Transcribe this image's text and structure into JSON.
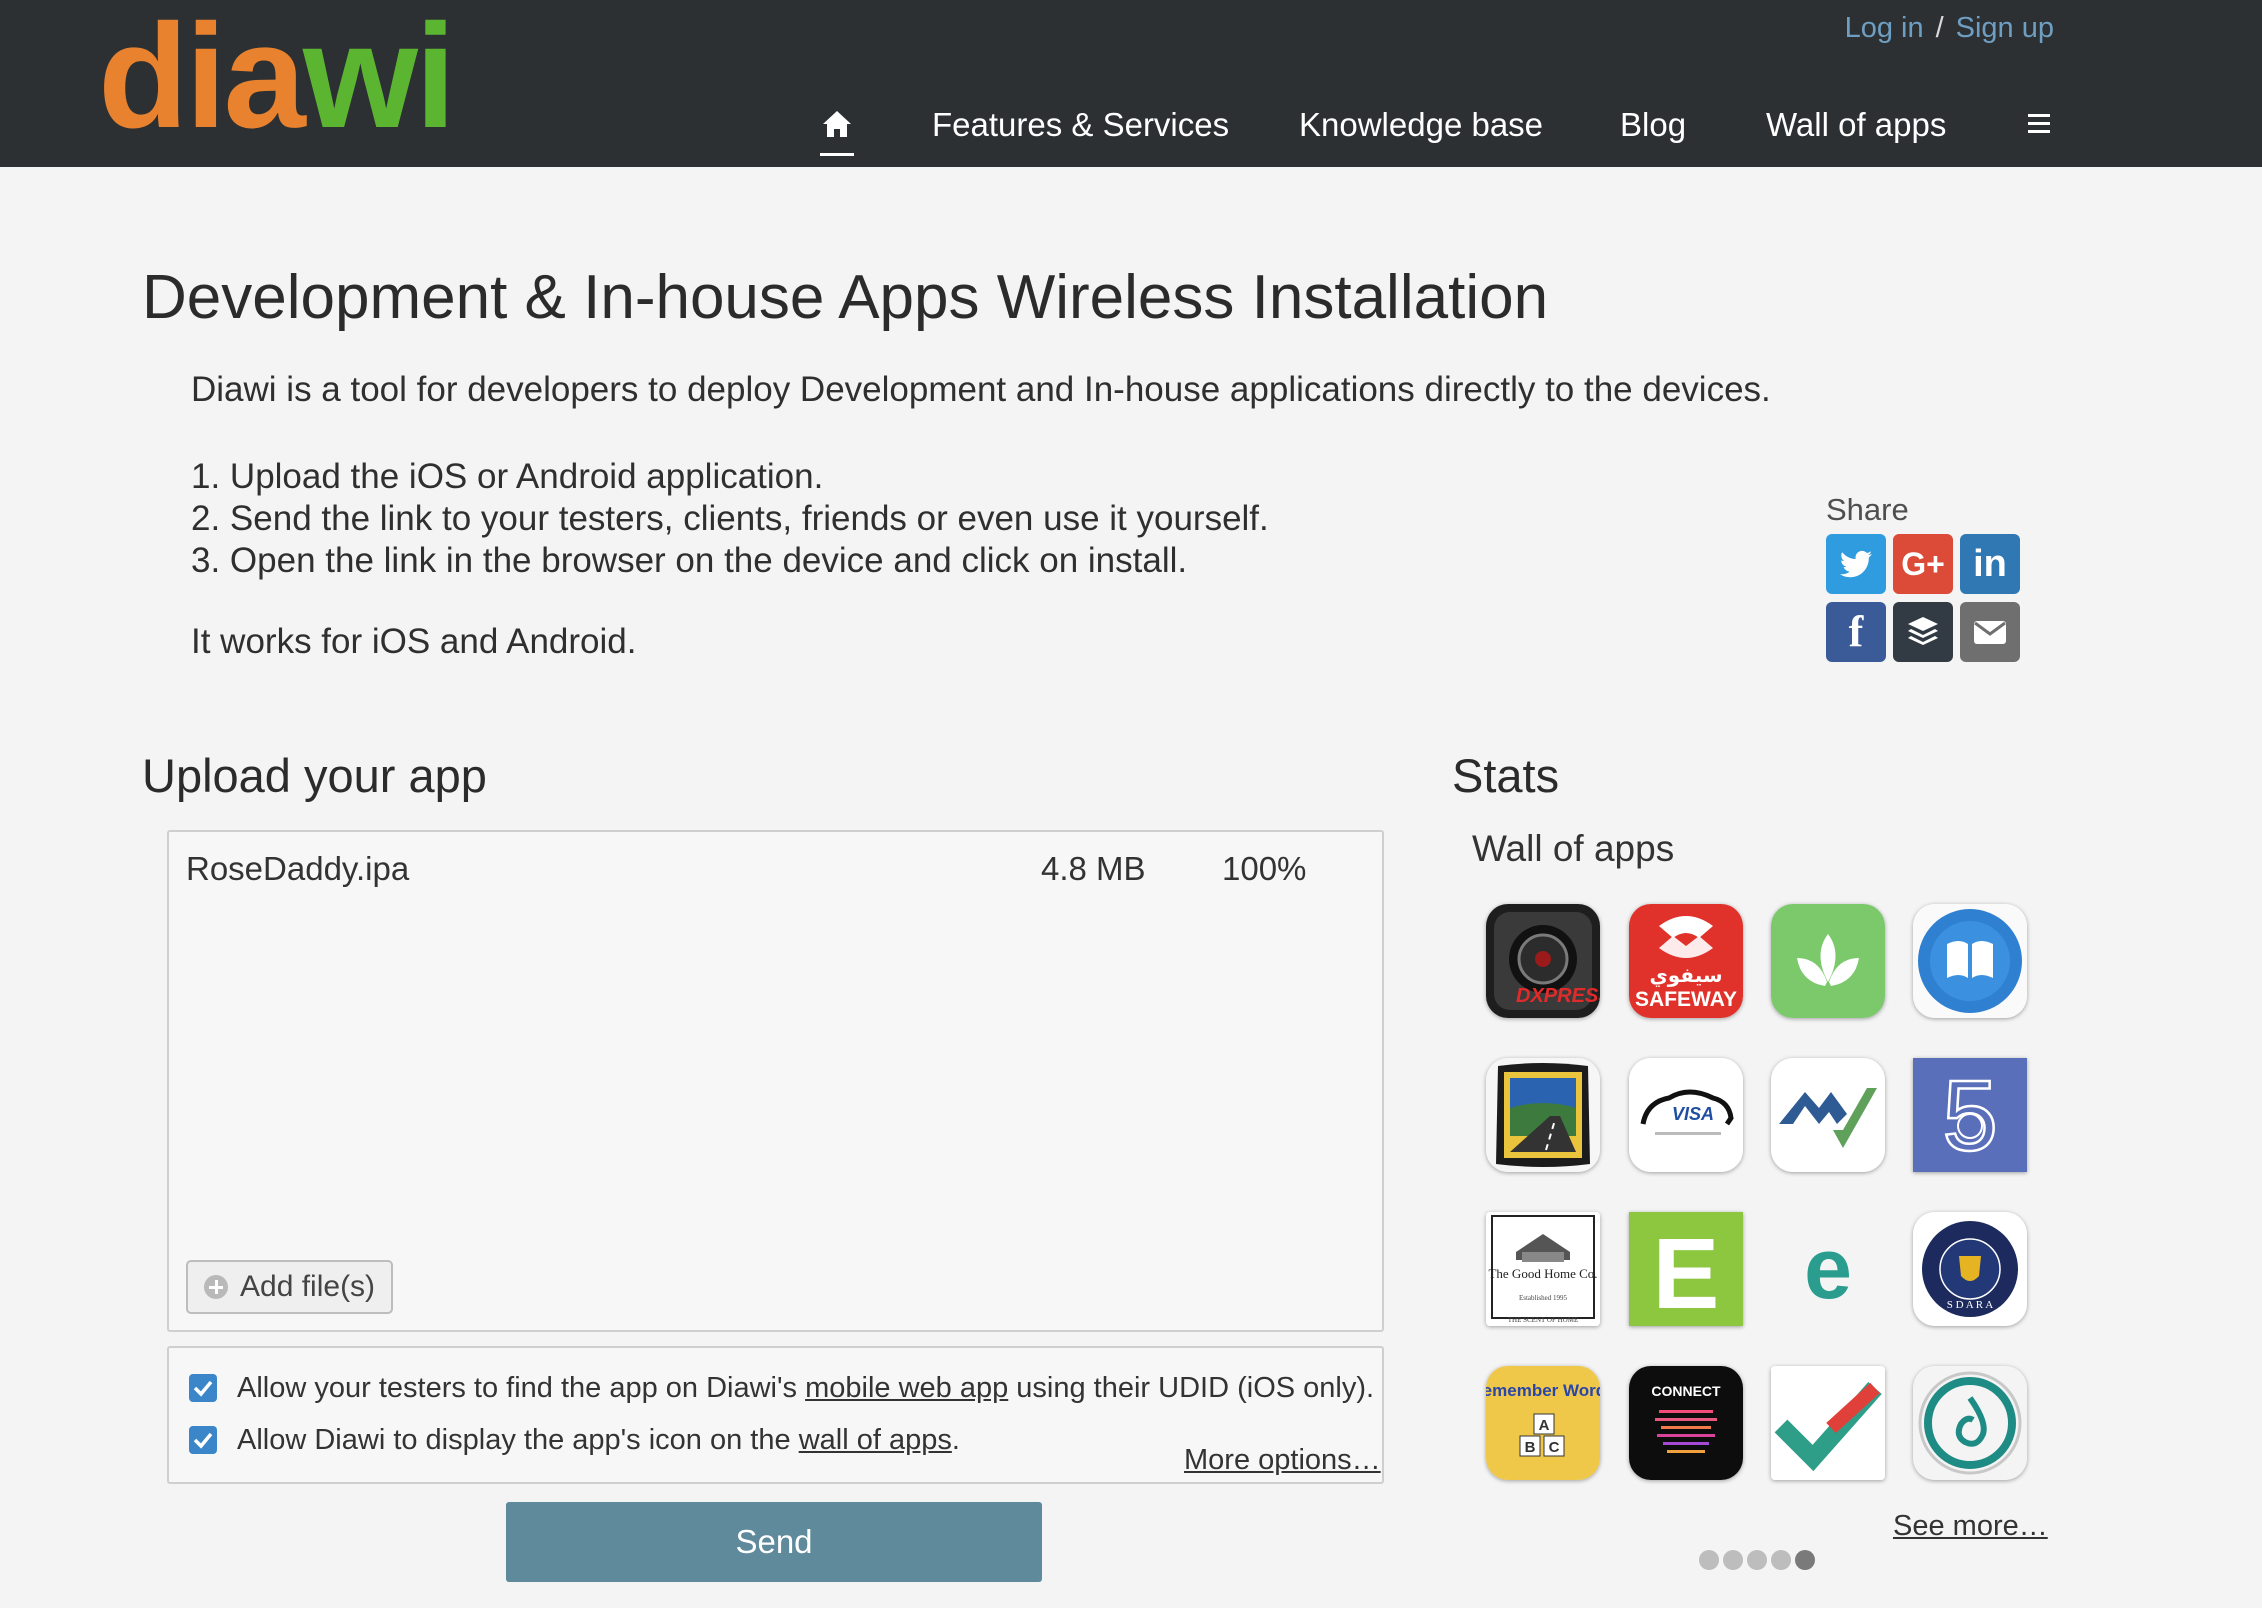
{
  "brand": {
    "part1": "dia",
    "part2": "wi"
  },
  "auth": {
    "login": "Log in",
    "separator": "/",
    "signup": "Sign up"
  },
  "nav": {
    "home_icon": "home-icon",
    "items": [
      "Features & Services",
      "Knowledge base",
      "Blog",
      "Wall of apps"
    ],
    "menu_icon": "hamburger-icon"
  },
  "intro": {
    "title": "Development & In-house Apps Wireless Installation",
    "description": "Diawi is a tool for developers to deploy Development and In-house applications directly to the devices.",
    "steps": [
      "1. Upload the iOS or Android application.",
      "2. Send the link to your testers, clients, friends or even use it yourself.",
      "3. Open the link in the browser on the device and click on install."
    ],
    "platforms": "It works for iOS and Android."
  },
  "share": {
    "label": "Share",
    "buttons": [
      {
        "name": "twitter",
        "icon": "twitter-icon",
        "color": "#2e9cde"
      },
      {
        "name": "google-plus",
        "icon": "google-plus-icon",
        "glyph": "G+",
        "color": "#dc4a38"
      },
      {
        "name": "linkedin",
        "icon": "linkedin-icon",
        "glyph": "in",
        "color": "#2f78b4"
      },
      {
        "name": "facebook",
        "icon": "facebook-icon",
        "glyph": "f",
        "color": "#3a5a98"
      },
      {
        "name": "buffer",
        "icon": "buffer-icon",
        "color": "#323b43"
      },
      {
        "name": "email",
        "icon": "envelope-icon",
        "color": "#6f6f6f"
      }
    ]
  },
  "upload": {
    "heading": "Upload your app",
    "file": {
      "name": "RoseDaddy.ipa",
      "size": "4.8 MB",
      "progress": "100%"
    },
    "add_files_label": "Add file(s)",
    "options": [
      {
        "checked": true,
        "before": "Allow your testers to find the app on Diawi's ",
        "link": "mobile web app",
        "after": " using their UDID (iOS only)."
      },
      {
        "checked": true,
        "before": "Allow Diawi to display the app's icon on the ",
        "link": "wall of apps",
        "after": "."
      }
    ],
    "more_options": "More options…",
    "send_label": "Send"
  },
  "stats": {
    "heading": "Stats",
    "wall_title": "Wall of apps",
    "apps": [
      {
        "icon": "dxp-recorder-icon",
        "label": "DXPRESS"
      },
      {
        "icon": "safeway-icon",
        "label": "SAFEWAY",
        "label_ar": "سيفوي"
      },
      {
        "icon": "green-leaf-icon"
      },
      {
        "icon": "open-book-icon"
      },
      {
        "icon": "landscape-road-icon"
      },
      {
        "icon": "visa-car-icon",
        "label": "VISA"
      },
      {
        "icon": "mountain-check-icon"
      },
      {
        "icon": "five-s-icon",
        "label": "5"
      },
      {
        "icon": "good-home-co-icon",
        "label": "The Good Home Co.",
        "sub": "Established 1995",
        "tagline": "THE SCENT OF HOME"
      },
      {
        "icon": "letter-e-icon",
        "label": "E"
      },
      {
        "icon": "teal-e-icon",
        "label": "e"
      },
      {
        "icon": "sdara-badge-icon",
        "label": "S D A R A"
      },
      {
        "icon": "remember-words-icon",
        "label": "Remember Words",
        "blocks": [
          "A",
          "B",
          "C"
        ]
      },
      {
        "icon": "connect-icon",
        "label": "CONNECT"
      },
      {
        "icon": "checkmark-icon"
      },
      {
        "icon": "drop-ring-icon"
      }
    ],
    "see_more": "See more…",
    "pager": {
      "pages": 5,
      "active": 5
    }
  }
}
